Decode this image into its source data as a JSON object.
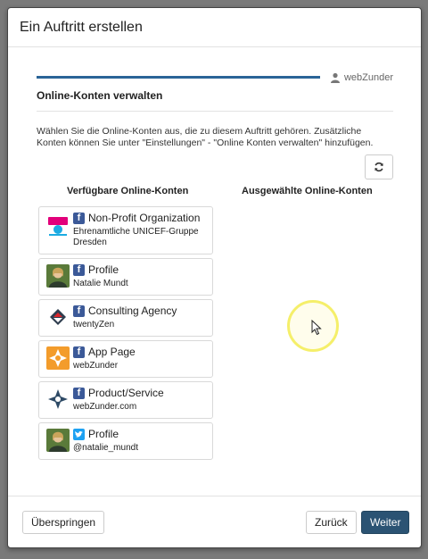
{
  "dialog": {
    "title": "Ein Auftritt erstellen"
  },
  "progress": {
    "value": 1.0
  },
  "account": {
    "username": "webZunder"
  },
  "section": {
    "title": "Online-Konten verwalten"
  },
  "intro": "Wählen Sie die Online-Konten aus, die zu diesem Auftritt gehören. Zusätzliche Konten können Sie unter \"Einstellungen\" - \"Online Konten verwalten\" hinzufügen.",
  "columns": {
    "available": "Verfügbare Online-Konten",
    "selected": "Ausgewählte Online-Konten"
  },
  "accounts": [
    {
      "network": "facebook",
      "type": "Non-Profit Organization",
      "name": "Ehrenamtliche UNICEF-Gruppe Dresden",
      "thumb": "unicef-logo"
    },
    {
      "network": "facebook",
      "type": "Profile",
      "name": "Natalie Mundt",
      "thumb": "person-photo"
    },
    {
      "network": "facebook",
      "type": "Consulting Agency",
      "name": "twentyZen",
      "thumb": "twentyzen-logo"
    },
    {
      "network": "facebook",
      "type": "App Page",
      "name": "webZunder",
      "thumb": "webzunder-orange-logo"
    },
    {
      "network": "facebook",
      "type": "Product/Service",
      "name": "webZunder.com",
      "thumb": "webzunder-blue-logo"
    },
    {
      "network": "twitter",
      "type": "Profile",
      "name": "@natalie_mundt",
      "thumb": "person-photo"
    }
  ],
  "buttons": {
    "skip": "Überspringen",
    "back": "Zurück",
    "next": "Weiter"
  },
  "icons": {
    "user": "user-icon",
    "refresh": "refresh-icon",
    "facebook": "facebook-icon",
    "twitter": "twitter-icon"
  },
  "colors": {
    "primary": "#2b5373",
    "progress": "#2a6497",
    "facebook": "#3b5998",
    "twitter": "#1da1f2",
    "highlight": "#f5ef6a"
  }
}
